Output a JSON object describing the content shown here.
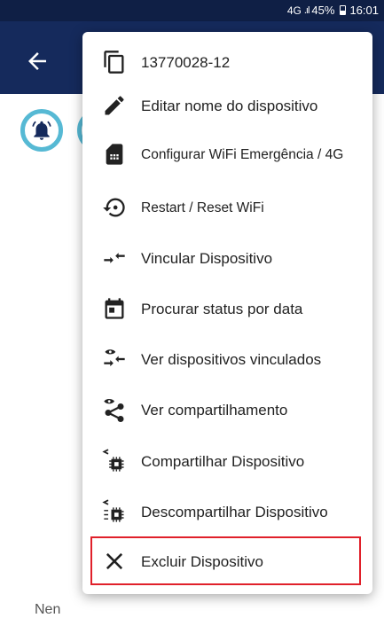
{
  "status_bar": {
    "network": "4G",
    "signal": ".ıl",
    "battery": "45%",
    "time": "16:01"
  },
  "colors": {
    "status_bar": "#0f1f45",
    "app_bar": "#152a5c",
    "accent_circle": "#56b9d4",
    "highlight": "#e0202a"
  },
  "background": {
    "bottom_text": "Nen"
  },
  "menu": {
    "items": [
      {
        "label": "13770028-12",
        "icon": "copy-icon"
      },
      {
        "label": "Editar nome do dispositivo",
        "icon": "pencil-icon"
      },
      {
        "label": "Configurar WiFi Emergência / 4G",
        "icon": "sim-card-icon"
      },
      {
        "label": "Restart / Reset WiFi",
        "icon": "restart-icon"
      },
      {
        "label": "Vincular Dispositivo",
        "icon": "link-arrows-icon"
      },
      {
        "label": "Procurar status por data",
        "icon": "calendar-icon"
      },
      {
        "label": "Ver dispositivos vinculados",
        "icon": "eye-arrows-icon"
      },
      {
        "label": "Ver compartilhamento",
        "icon": "eye-share-icon"
      },
      {
        "label": "Compartilhar Dispositivo",
        "icon": "share-chip-icon"
      },
      {
        "label": "Descompartilhar Dispositivo",
        "icon": "unshare-chip-icon"
      },
      {
        "label": "Excluir Dispositivo",
        "icon": "close-icon"
      }
    ]
  }
}
